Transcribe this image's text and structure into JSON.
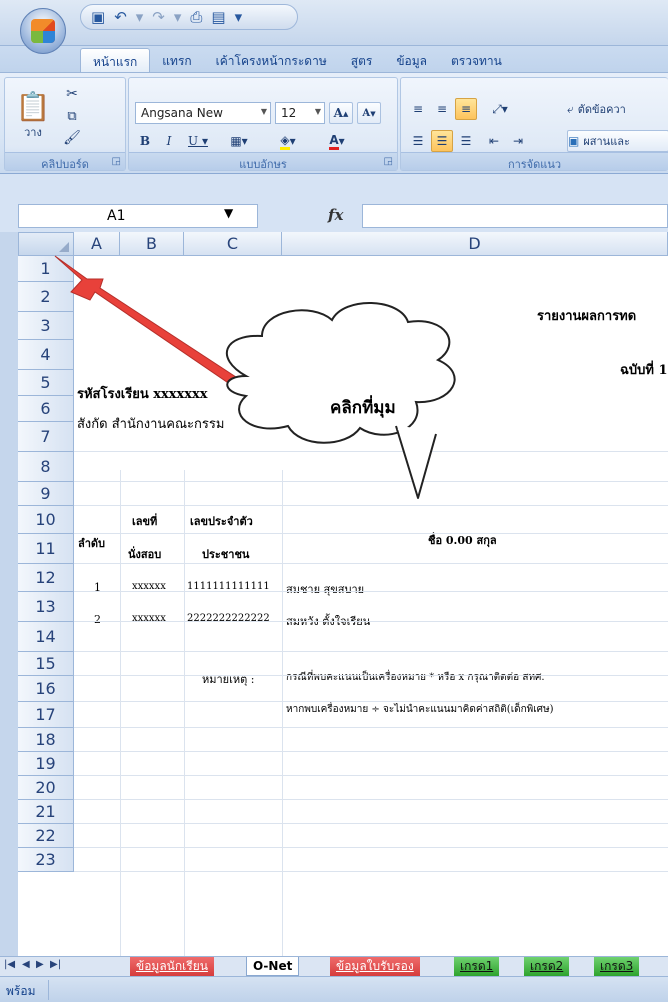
{
  "ribbon_tabs": [
    "หน้าแรก",
    "แทรก",
    "เค้าโครงหน้ากระดาษ",
    "สูตร",
    "ข้อมูล",
    "ตรวจทาน"
  ],
  "ribbon": {
    "clipboard": {
      "paste_label": "วาง",
      "group_label": "คลิปบอร์ด"
    },
    "font": {
      "font_name": "Angsana New",
      "font_size": "12",
      "group_label": "แบบอักษร"
    },
    "alignment": {
      "wrap_label": "ตัดข้อควา",
      "merge_label": "ผสานและ",
      "group_label": "การจัดแนว"
    }
  },
  "formula_bar": {
    "name_box": "A1",
    "fx_label": "fx",
    "formula": ""
  },
  "columns": [
    "A",
    "B",
    "C",
    "D"
  ],
  "rows": [
    "1",
    "2",
    "3",
    "4",
    "5",
    "6",
    "7",
    "8",
    "9",
    "10",
    "11",
    "12",
    "13",
    "14",
    "15",
    "16",
    "17",
    "18",
    "19",
    "20",
    "21",
    "22",
    "23"
  ],
  "cells": {
    "r2_title": "รายงานผลการทด",
    "r4_edition": "ฉบับที่ 1",
    "r5_school": "รหัสโรงเรียน xxxxxxx",
    "r6_affiliation": "สังกัด สำนักงานคณะกรรม",
    "r8_order": "ลำดับ",
    "r8_seat_top": "เลขที่",
    "r8_seat_bottom": "นั่งสอบ",
    "r8_id_top": "เลขประจำตัว",
    "r8_id_bottom": "ประชาชน",
    "r8_name": "ชื่อ 0.00 สกุล",
    "r10": {
      "order": "1",
      "seat": "xxxxxx",
      "id": "1111111111111",
      "name": "สมชาย สุขสบาย"
    },
    "r11": {
      "order": "2",
      "seat": "xxxxxx",
      "id": "2222222222222",
      "name": "สมหวัง ตั้งใจเรียน"
    },
    "r13_note_label": "หมายเหตุ :",
    "r13_note": "กรณีที่พบคะแนนเป็นเครื่องหมาย * หรือ x กรุณาติดต่อ สทศ.",
    "r14_note": "หากพบเครื่องหมาย ÷ จะไม่นำคะแนนมาคิดค่าสถิติ(เด็กพิเศษ)"
  },
  "sheet_tabs": [
    {
      "label": "ข้อมูลนักเรียน",
      "style": "red"
    },
    {
      "label": "O-Net",
      "style": "active"
    },
    {
      "label": "ข้อมูลใบรับรอง",
      "style": "red"
    },
    {
      "label": "เกรด1",
      "style": "green"
    },
    {
      "label": "เกรด2",
      "style": "green"
    },
    {
      "label": "เกรด3",
      "style": "green"
    }
  ],
  "status": "พร้อม",
  "annotation": {
    "callout_text": "คลิกที่มุม",
    "arrow_color": "#e8413a"
  },
  "colors": {
    "ribbon": "#d8e5f5",
    "header": "#d6e2f2",
    "tab_red": "#d63c3c",
    "tab_green": "#2ea32e"
  }
}
